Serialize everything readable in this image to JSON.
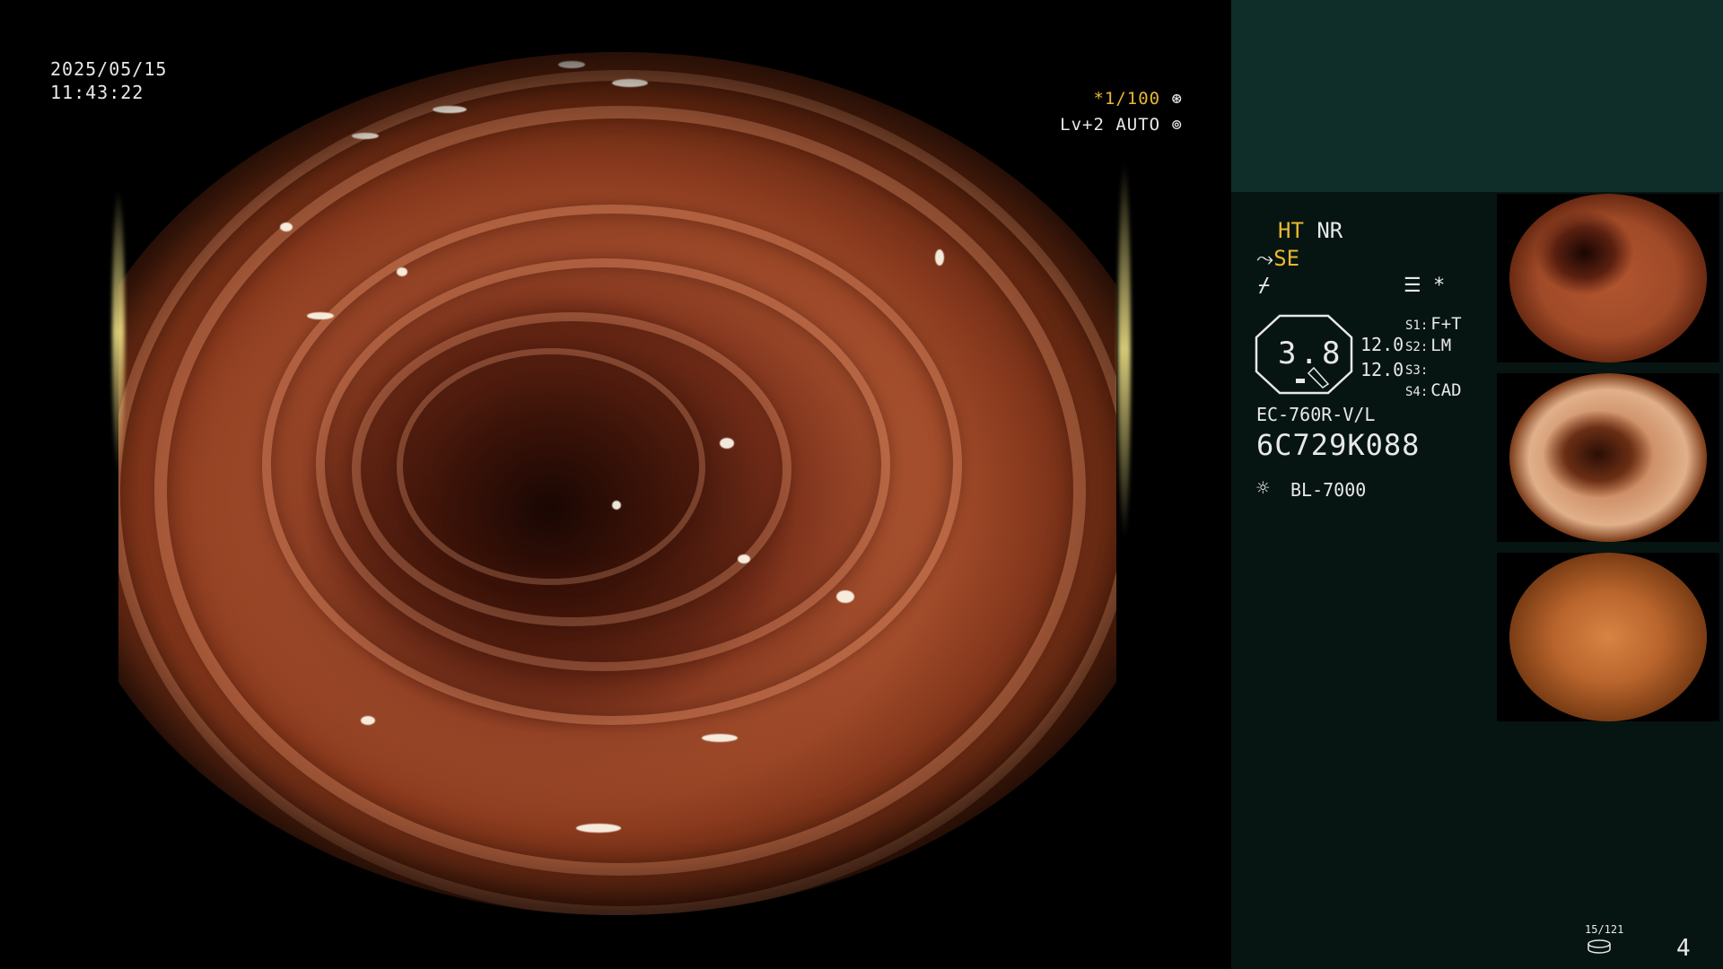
{
  "overlay": {
    "date": "2025/05/15",
    "time": "11:43:22",
    "shutter_prefix": "*",
    "shutter_speed": "1/100",
    "shutter_icon": "aperture-icon",
    "agc": "Lv+2 AUTO",
    "agc_icon": "auto-iris-icon"
  },
  "panel": {
    "ht": "HT",
    "nr": "NR",
    "se": "SE",
    "enhance_symbol": "⌿",
    "structure_symbol": "☰",
    "asterisk": "*",
    "zoom_value": "3.8",
    "value_a": "12.0",
    "value_b": "12.0",
    "s_items": [
      {
        "key": "S1:",
        "value": "F+T"
      },
      {
        "key": "S2:",
        "value": "LM"
      },
      {
        "key": "S3:",
        "value": ""
      },
      {
        "key": "S4:",
        "value": "CAD"
      }
    ],
    "scope_model": "EC-760R-V/L",
    "scope_serial": "6C729K088",
    "light_source": "BL-7000",
    "light_icon": "sun-icon",
    "counter": "15/121",
    "page_number": "4"
  },
  "colors": {
    "panel_bg": "#071512",
    "panel_top_bg": "#0f2e2a",
    "accent_yellow": "#e9b830",
    "text": "#e8e8e8"
  }
}
